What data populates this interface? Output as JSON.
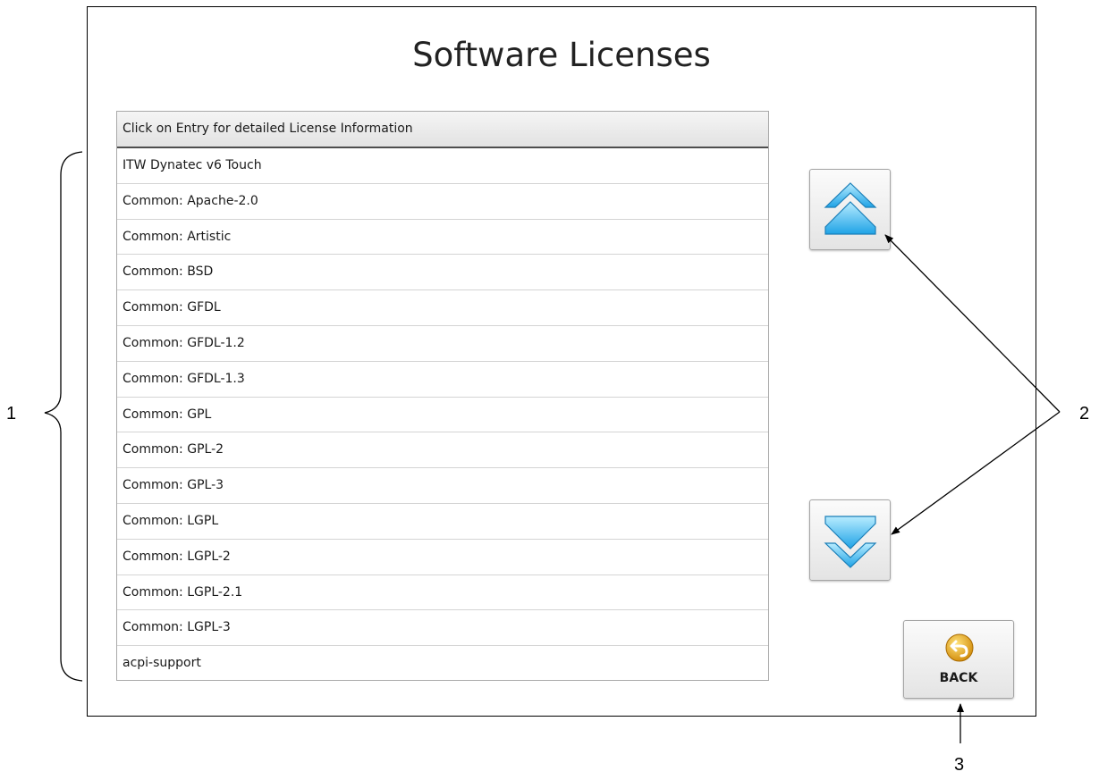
{
  "screen": {
    "title": "Software Licenses"
  },
  "license_table": {
    "header": "Click on Entry for detailed License Information",
    "rows": [
      "ITW Dynatec v6 Touch",
      "Common: Apache-2.0",
      "Common: Artistic",
      "Common: BSD",
      "Common: GFDL",
      "Common: GFDL-1.2",
      "Common: GFDL-1.3",
      "Common: GPL",
      "Common: GPL-2",
      "Common: GPL-3",
      "Common: LGPL",
      "Common: LGPL-2",
      "Common: LGPL-2.1",
      "Common: LGPL-3",
      "acpi-support"
    ]
  },
  "buttons": {
    "scroll_up_icon": "double-chevron-up-icon",
    "scroll_down_icon": "double-chevron-down-icon",
    "back_label": "BACK",
    "back_icon": "back-arrow-icon"
  },
  "callouts": {
    "one": "1",
    "two": "2",
    "three": "3"
  },
  "colors": {
    "arrow_blue": "#3fb6ee",
    "back_icon_gold": "#e0a21a"
  }
}
